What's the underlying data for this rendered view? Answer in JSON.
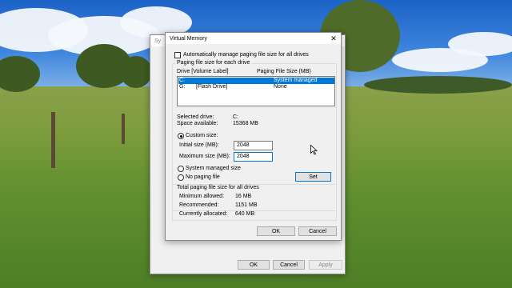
{
  "back_window": {
    "title_fragment": "Sy",
    "ok_label": "OK",
    "cancel_label": "Cancel",
    "apply_label": "Apply"
  },
  "dialog": {
    "title": "Virtual Memory",
    "auto_manage_label": "Automatically manage paging file size for all drives",
    "auto_manage_checked": false,
    "paging_group_label": "Paging file size for each drive",
    "col_drive": "Drive  [Volume Label]",
    "col_size": "Paging File Size (MB)",
    "drives": [
      {
        "drive": "C:",
        "label": "",
        "size": "System managed",
        "selected": true
      },
      {
        "drive": "G:",
        "label": "[Flash Drive]",
        "size": "None",
        "selected": false
      }
    ],
    "selected_drive_label": "Selected drive:",
    "selected_drive_value": "C:",
    "space_available_label": "Space available:",
    "space_available_value": "15368 MB",
    "custom_size_label": "Custom size:",
    "initial_size_label": "Initial size (MB):",
    "initial_size_value": "2048",
    "maximum_size_label": "Maximum size (MB):",
    "maximum_size_value": "2048",
    "system_managed_label": "System managed size",
    "no_paging_label": "No paging file",
    "selected_option": "custom",
    "set_label": "Set",
    "total_group_label": "Total paging file size for all drives",
    "min_allowed_label": "Minimum allowed:",
    "min_allowed_value": "16 MB",
    "recommended_label": "Recommended:",
    "recommended_value": "1151 MB",
    "currently_allocated_label": "Currently allocated:",
    "currently_allocated_value": "640 MB",
    "ok_label": "OK",
    "cancel_label": "Cancel",
    "close_glyph": "✕"
  },
  "colors": {
    "accent": "#0078d7",
    "dialog_bg": "#f0f0f0"
  },
  "icons": [
    "close-icon",
    "mouse-cursor-icon"
  ]
}
